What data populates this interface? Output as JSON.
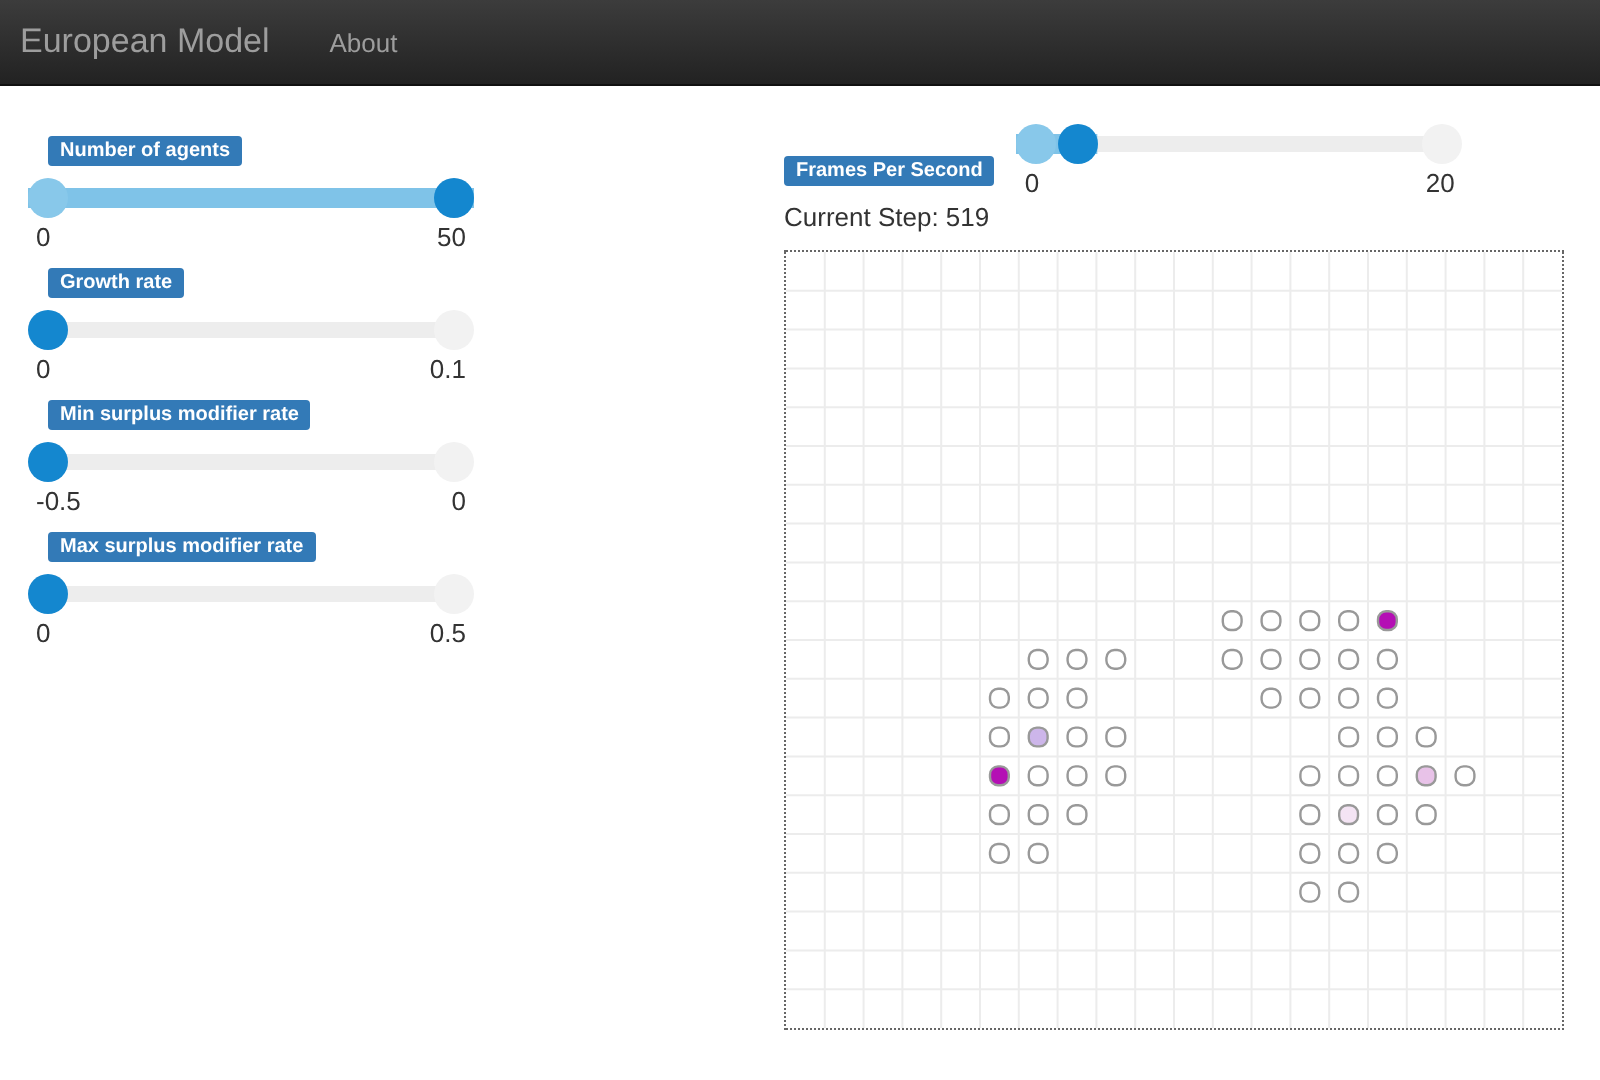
{
  "navbar": {
    "brand": "European Model",
    "links": [
      {
        "label": "About"
      }
    ]
  },
  "sliders": [
    {
      "label": "Number of agents",
      "min": "0",
      "max": "50",
      "level": 1
    },
    {
      "label": "Growth rate",
      "min": "0",
      "max": "0.1",
      "level": 0
    },
    {
      "label": "Min surplus modifier rate",
      "min": "-0.5",
      "max": "0",
      "level": 0
    },
    {
      "label": "Max surplus modifier rate",
      "min": "0",
      "max": "0.5",
      "level": 0
    }
  ],
  "fps": {
    "label": "Frames Per Second",
    "min": "0",
    "max": "20",
    "level": 0.1
  },
  "current_step": "Current Step: 519",
  "grid": {
    "cells": [
      [
        null,
        null,
        null,
        null,
        null,
        null,
        null,
        null,
        null,
        null,
        null,
        null,
        null,
        null,
        null,
        null,
        null,
        null,
        null,
        null
      ],
      [
        null,
        null,
        null,
        null,
        null,
        null,
        null,
        null,
        null,
        null,
        null,
        null,
        null,
        null,
        null,
        null,
        null,
        null,
        null,
        null
      ],
      [
        null,
        null,
        null,
        null,
        null,
        null,
        null,
        null,
        null,
        null,
        null,
        null,
        null,
        null,
        null,
        null,
        null,
        null,
        null,
        null
      ],
      [
        null,
        null,
        null,
        null,
        null,
        null,
        null,
        null,
        null,
        null,
        null,
        null,
        null,
        null,
        null,
        null,
        null,
        null,
        null,
        null
      ],
      [
        null,
        null,
        null,
        null,
        null,
        null,
        null,
        null,
        null,
        null,
        null,
        null,
        null,
        null,
        null,
        null,
        null,
        null,
        null,
        null
      ],
      [
        null,
        null,
        null,
        null,
        null,
        null,
        null,
        null,
        null,
        null,
        null,
        null,
        null,
        null,
        null,
        null,
        null,
        null,
        null,
        null
      ],
      [
        null,
        null,
        null,
        null,
        null,
        null,
        null,
        null,
        null,
        null,
        null,
        null,
        null,
        null,
        null,
        null,
        null,
        null,
        null,
        null
      ],
      [
        null,
        null,
        null,
        null,
        null,
        null,
        null,
        null,
        null,
        null,
        null,
        null,
        null,
        null,
        null,
        null,
        null,
        null,
        null,
        null
      ],
      [
        null,
        null,
        null,
        null,
        null,
        null,
        null,
        null,
        null,
        null,
        null,
        null,
        null,
        null,
        null,
        null,
        null,
        null,
        null,
        null
      ],
      [
        null,
        null,
        null,
        null,
        null,
        null,
        null,
        null,
        null,
        null,
        null,
        {
          "color": "#ffffff"
        },
        {
          "color": "#ffffff"
        },
        {
          "color": "#ffffff"
        },
        {
          "color": "#ffffff"
        },
        {
          "color": "#b40fb4"
        },
        null,
        null,
        null,
        null
      ],
      [
        null,
        null,
        null,
        null,
        null,
        null,
        {
          "color": "#ffffff"
        },
        {
          "color": "#ffffff"
        },
        {
          "color": "#ffffff"
        },
        null,
        null,
        {
          "color": "#ffffff"
        },
        {
          "color": "#ffffff"
        },
        {
          "color": "#ffffff"
        },
        {
          "color": "#ffffff"
        },
        {
          "color": "#ffffff"
        },
        null,
        null,
        null,
        null
      ],
      [
        null,
        null,
        null,
        null,
        null,
        {
          "color": "#ffffff"
        },
        {
          "color": "#ffffff"
        },
        {
          "color": "#ffffff"
        },
        null,
        null,
        null,
        null,
        {
          "color": "#ffffff"
        },
        {
          "color": "#ffffff"
        },
        {
          "color": "#ffffff"
        },
        {
          "color": "#ffffff"
        },
        null,
        null,
        null,
        null
      ],
      [
        null,
        null,
        null,
        null,
        null,
        {
          "color": "#ffffff"
        },
        {
          "color": "#cdb6ea"
        },
        {
          "color": "#ffffff"
        },
        {
          "color": "#ffffff"
        },
        null,
        null,
        null,
        null,
        null,
        {
          "color": "#ffffff"
        },
        {
          "color": "#ffffff"
        },
        {
          "color": "#ffffff"
        },
        null,
        null,
        null
      ],
      [
        null,
        null,
        null,
        null,
        null,
        {
          "color": "#b40fb4"
        },
        {
          "color": "#ffffff"
        },
        {
          "color": "#ffffff"
        },
        {
          "color": "#ffffff"
        },
        null,
        null,
        null,
        null,
        {
          "color": "#ffffff"
        },
        {
          "color": "#ffffff"
        },
        {
          "color": "#ffffff"
        },
        {
          "color": "#e8c2e8"
        },
        {
          "color": "#ffffff"
        },
        null,
        null
      ],
      [
        null,
        null,
        null,
        null,
        null,
        {
          "color": "#ffffff"
        },
        {
          "color": "#ffffff"
        },
        {
          "color": "#ffffff"
        },
        null,
        null,
        null,
        null,
        null,
        {
          "color": "#ffffff"
        },
        {
          "color": "#f4e4f4"
        },
        {
          "color": "#ffffff"
        },
        {
          "color": "#ffffff"
        },
        null,
        null,
        null
      ],
      [
        null,
        null,
        null,
        null,
        null,
        {
          "color": "#ffffff"
        },
        {
          "color": "#ffffff"
        },
        null,
        null,
        null,
        null,
        null,
        null,
        {
          "color": "#ffffff"
        },
        {
          "color": "#ffffff"
        },
        {
          "color": "#ffffff"
        },
        null,
        null,
        null,
        null
      ],
      [
        null,
        null,
        null,
        null,
        null,
        null,
        null,
        null,
        null,
        null,
        null,
        null,
        null,
        {
          "color": "#ffffff"
        },
        {
          "color": "#ffffff"
        },
        null,
        null,
        null,
        null,
        null
      ],
      [
        null,
        null,
        null,
        null,
        null,
        null,
        null,
        null,
        null,
        null,
        null,
        null,
        null,
        null,
        null,
        null,
        null,
        null,
        null,
        null
      ],
      [
        null,
        null,
        null,
        null,
        null,
        null,
        null,
        null,
        null,
        null,
        null,
        null,
        null,
        null,
        null,
        null,
        null,
        null,
        null,
        null
      ],
      [
        null,
        null,
        null,
        null,
        null,
        null,
        null,
        null,
        null,
        null,
        null,
        null,
        null,
        null,
        null,
        null,
        null,
        null,
        null,
        null
      ]
    ]
  }
}
